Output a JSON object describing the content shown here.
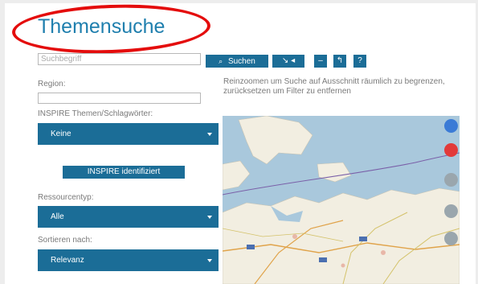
{
  "page": {
    "title": "Themensuche"
  },
  "search": {
    "placeholder": "Suchbegriff",
    "button_label": "Suchen",
    "button_icon": "magnifier-icon"
  },
  "toolbar": {
    "buttons": [
      {
        "icon": "collapse-arrows-icon",
        "glyph": "↘ ◂"
      },
      {
        "icon": "minus-icon",
        "glyph": "–"
      },
      {
        "icon": "undo-arrow-icon",
        "glyph": "↰"
      },
      {
        "icon": "help-icon",
        "glyph": "?"
      }
    ]
  },
  "region": {
    "label": "Region:"
  },
  "inspire_themes": {
    "label": "INSPIRE Themen/Schlagwörter:",
    "selected": "Keine"
  },
  "inspire_identified_button": "INSPIRE identifiziert",
  "resource_type": {
    "label": "Ressourcentyp:",
    "selected": "Alle"
  },
  "sort": {
    "label": "Sortieren nach:",
    "selected": "Relevanz"
  },
  "map": {
    "hint": "Reinzoomen um Suche auf Ausschnitt räumlich zu begrenzen, zurücksetzen um Filter zu entfernen",
    "controls": [
      {
        "icon": "pan-navigation-icon",
        "color": "#3b7bd6"
      },
      {
        "icon": "move-cross-icon",
        "color": "#e23a3a"
      },
      {
        "icon": "zoom-in-icon",
        "color": "#9aa6ad"
      },
      {
        "icon": "zoom-out-icon",
        "color": "#9aa6ad"
      },
      {
        "icon": "zoom-minus-icon",
        "color": "#9aa6ad"
      }
    ]
  },
  "colors": {
    "accent": "#1b6d97",
    "title": "#1f7fae",
    "highlight": "#e40c0c"
  }
}
